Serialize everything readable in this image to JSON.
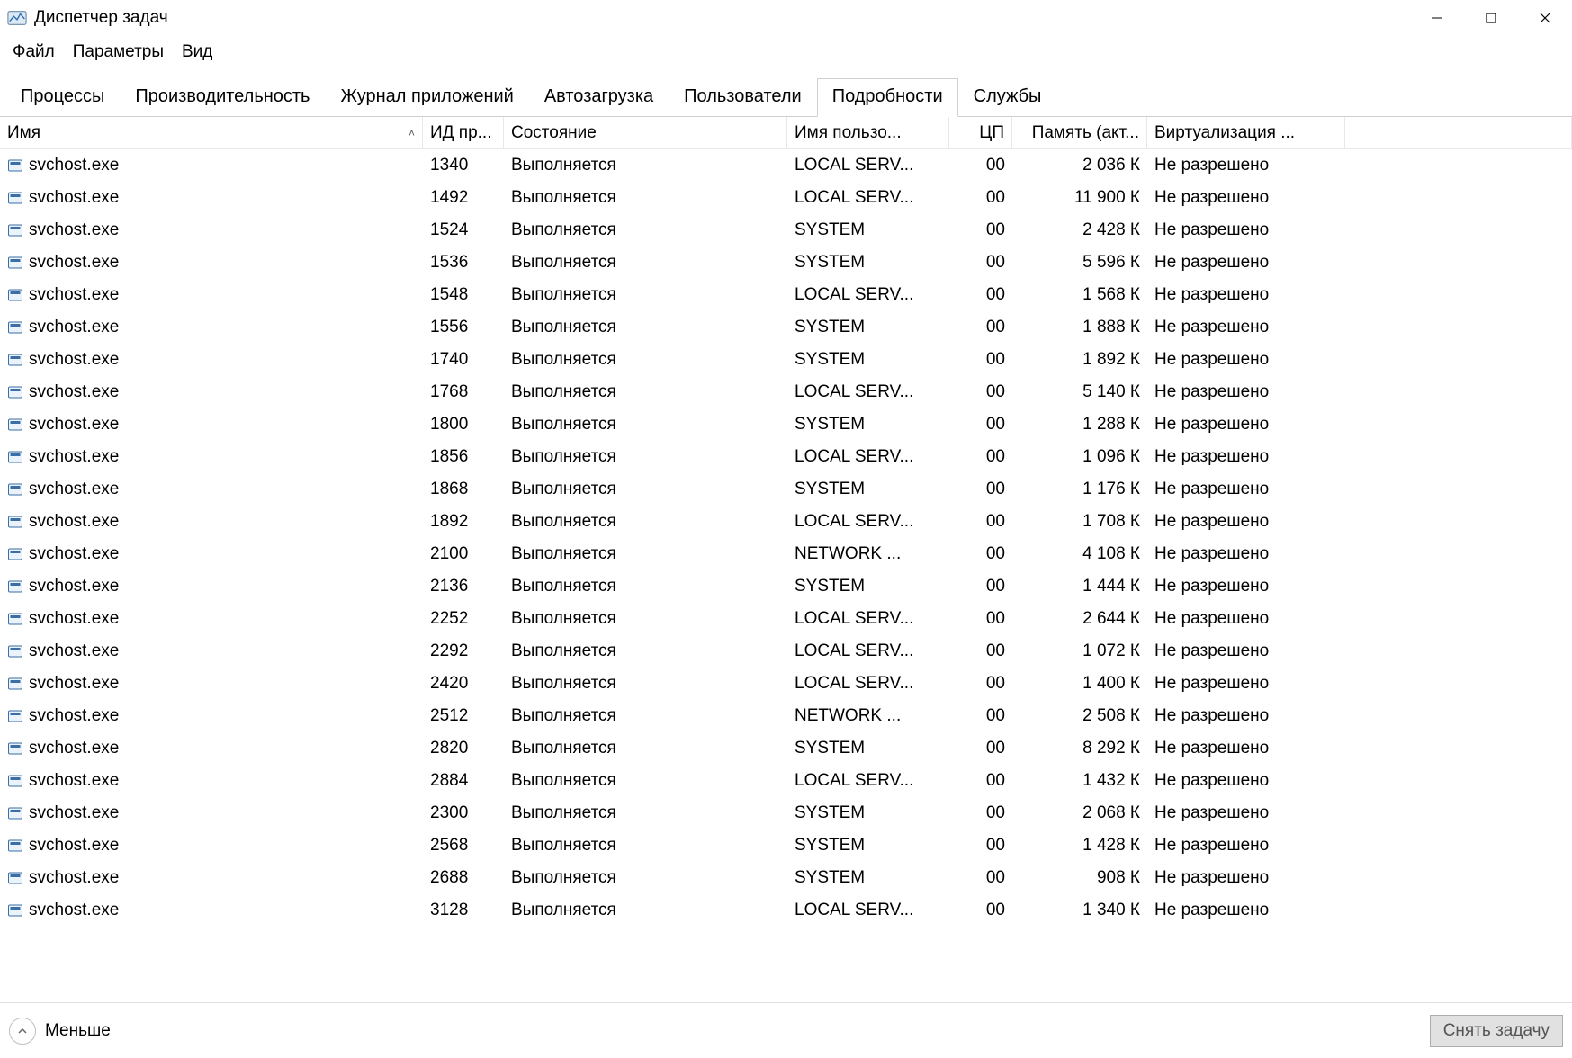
{
  "window": {
    "title": "Диспетчер задач"
  },
  "menu": {
    "items": [
      "Файл",
      "Параметры",
      "Вид"
    ]
  },
  "tabs": {
    "items": [
      "Процессы",
      "Производительность",
      "Журнал приложений",
      "Автозагрузка",
      "Пользователи",
      "Подробности",
      "Службы"
    ],
    "active_index": 5
  },
  "columns": {
    "name": "Имя",
    "pid": "ИД пр...",
    "status": "Состояние",
    "user": "Имя пользо...",
    "cpu": "ЦП",
    "memory": "Память (акт...",
    "virt": "Виртуализация ..."
  },
  "rows": [
    {
      "name": "svchost.exe",
      "pid": "1340",
      "status": "Выполняется",
      "user": "LOCAL SERV...",
      "cpu": "00",
      "mem": "2 036 К",
      "virt": "Не разрешено"
    },
    {
      "name": "svchost.exe",
      "pid": "1492",
      "status": "Выполняется",
      "user": "LOCAL SERV...",
      "cpu": "00",
      "mem": "11 900 К",
      "virt": "Не разрешено"
    },
    {
      "name": "svchost.exe",
      "pid": "1524",
      "status": "Выполняется",
      "user": "SYSTEM",
      "cpu": "00",
      "mem": "2 428 К",
      "virt": "Не разрешено"
    },
    {
      "name": "svchost.exe",
      "pid": "1536",
      "status": "Выполняется",
      "user": "SYSTEM",
      "cpu": "00",
      "mem": "5 596 К",
      "virt": "Не разрешено"
    },
    {
      "name": "svchost.exe",
      "pid": "1548",
      "status": "Выполняется",
      "user": "LOCAL SERV...",
      "cpu": "00",
      "mem": "1 568 К",
      "virt": "Не разрешено"
    },
    {
      "name": "svchost.exe",
      "pid": "1556",
      "status": "Выполняется",
      "user": "SYSTEM",
      "cpu": "00",
      "mem": "1 888 К",
      "virt": "Не разрешено"
    },
    {
      "name": "svchost.exe",
      "pid": "1740",
      "status": "Выполняется",
      "user": "SYSTEM",
      "cpu": "00",
      "mem": "1 892 К",
      "virt": "Не разрешено"
    },
    {
      "name": "svchost.exe",
      "pid": "1768",
      "status": "Выполняется",
      "user": "LOCAL SERV...",
      "cpu": "00",
      "mem": "5 140 К",
      "virt": "Не разрешено"
    },
    {
      "name": "svchost.exe",
      "pid": "1800",
      "status": "Выполняется",
      "user": "SYSTEM",
      "cpu": "00",
      "mem": "1 288 К",
      "virt": "Не разрешено"
    },
    {
      "name": "svchost.exe",
      "pid": "1856",
      "status": "Выполняется",
      "user": "LOCAL SERV...",
      "cpu": "00",
      "mem": "1 096 К",
      "virt": "Не разрешено"
    },
    {
      "name": "svchost.exe",
      "pid": "1868",
      "status": "Выполняется",
      "user": "SYSTEM",
      "cpu": "00",
      "mem": "1 176 К",
      "virt": "Не разрешено"
    },
    {
      "name": "svchost.exe",
      "pid": "1892",
      "status": "Выполняется",
      "user": "LOCAL SERV...",
      "cpu": "00",
      "mem": "1 708 К",
      "virt": "Не разрешено"
    },
    {
      "name": "svchost.exe",
      "pid": "2100",
      "status": "Выполняется",
      "user": "NETWORK ...",
      "cpu": "00",
      "mem": "4 108 К",
      "virt": "Не разрешено"
    },
    {
      "name": "svchost.exe",
      "pid": "2136",
      "status": "Выполняется",
      "user": "SYSTEM",
      "cpu": "00",
      "mem": "1 444 К",
      "virt": "Не разрешено"
    },
    {
      "name": "svchost.exe",
      "pid": "2252",
      "status": "Выполняется",
      "user": "LOCAL SERV...",
      "cpu": "00",
      "mem": "2 644 К",
      "virt": "Не разрешено"
    },
    {
      "name": "svchost.exe",
      "pid": "2292",
      "status": "Выполняется",
      "user": "LOCAL SERV...",
      "cpu": "00",
      "mem": "1 072 К",
      "virt": "Не разрешено"
    },
    {
      "name": "svchost.exe",
      "pid": "2420",
      "status": "Выполняется",
      "user": "LOCAL SERV...",
      "cpu": "00",
      "mem": "1 400 К",
      "virt": "Не разрешено"
    },
    {
      "name": "svchost.exe",
      "pid": "2512",
      "status": "Выполняется",
      "user": "NETWORK ...",
      "cpu": "00",
      "mem": "2 508 К",
      "virt": "Не разрешено"
    },
    {
      "name": "svchost.exe",
      "pid": "2820",
      "status": "Выполняется",
      "user": "SYSTEM",
      "cpu": "00",
      "mem": "8 292 К",
      "virt": "Не разрешено"
    },
    {
      "name": "svchost.exe",
      "pid": "2884",
      "status": "Выполняется",
      "user": "LOCAL SERV...",
      "cpu": "00",
      "mem": "1 432 К",
      "virt": "Не разрешено"
    },
    {
      "name": "svchost.exe",
      "pid": "2300",
      "status": "Выполняется",
      "user": "SYSTEM",
      "cpu": "00",
      "mem": "2 068 К",
      "virt": "Не разрешено"
    },
    {
      "name": "svchost.exe",
      "pid": "2568",
      "status": "Выполняется",
      "user": "SYSTEM",
      "cpu": "00",
      "mem": "1 428 К",
      "virt": "Не разрешено"
    },
    {
      "name": "svchost.exe",
      "pid": "2688",
      "status": "Выполняется",
      "user": "SYSTEM",
      "cpu": "00",
      "mem": "908 К",
      "virt": "Не разрешено"
    },
    {
      "name": "svchost.exe",
      "pid": "3128",
      "status": "Выполняется",
      "user": "LOCAL SERV...",
      "cpu": "00",
      "mem": "1 340 К",
      "virt": "Не разрешено"
    }
  ],
  "footer": {
    "less": "Меньше",
    "end_task": "Снять задачу"
  }
}
